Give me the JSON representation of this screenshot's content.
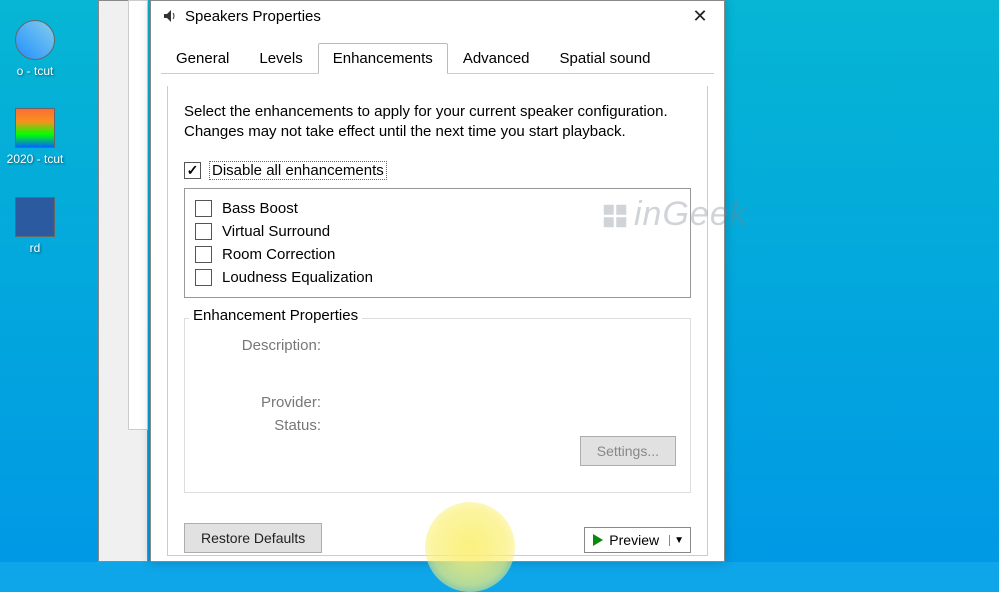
{
  "desktop": {
    "icons": [
      {
        "label": "o -\ntcut"
      },
      {
        "label": "2020 -\ntcut"
      },
      {
        "label": "rd"
      }
    ]
  },
  "dialog": {
    "title": "Speakers Properties"
  },
  "tabs": [
    {
      "label": "General",
      "active": false
    },
    {
      "label": "Levels",
      "active": false
    },
    {
      "label": "Enhancements",
      "active": true
    },
    {
      "label": "Advanced",
      "active": false
    },
    {
      "label": "Spatial sound",
      "active": false
    }
  ],
  "enhancements": {
    "description": "Select the enhancements to apply for your current speaker configuration. Changes may not take effect until the next time you start playback.",
    "disable_all": {
      "label": "Disable all enhancements",
      "checked": true
    },
    "items": [
      {
        "label": "Bass Boost",
        "checked": false
      },
      {
        "label": "Virtual Surround",
        "checked": false
      },
      {
        "label": "Room Correction",
        "checked": false
      },
      {
        "label": "Loudness Equalization",
        "checked": false
      }
    ]
  },
  "properties": {
    "legend": "Enhancement Properties",
    "description_label": "Description:",
    "provider_label": "Provider:",
    "status_label": "Status:",
    "settings_button": "Settings..."
  },
  "buttons": {
    "restore_defaults": "Restore Defaults",
    "preview": "Preview"
  },
  "watermark": "inGeek"
}
